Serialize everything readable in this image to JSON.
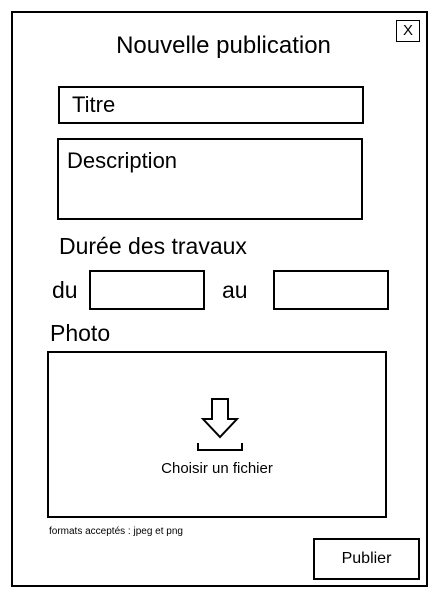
{
  "dialog": {
    "title": "Nouvelle publication",
    "close_label": "X"
  },
  "form": {
    "title_placeholder": "Titre",
    "title_value": "",
    "description_placeholder": "Description",
    "description_value": "",
    "duration_label": "Durée des travaux",
    "from_label": "du",
    "from_value": "",
    "to_label": "au",
    "to_value": "",
    "photo_label": "Photo",
    "dropzone": {
      "icon": "download-arrow-icon",
      "text": "Choisir un fichier"
    },
    "formats_note": "formats acceptés : jpeg et png",
    "submit_label": "Publier"
  }
}
